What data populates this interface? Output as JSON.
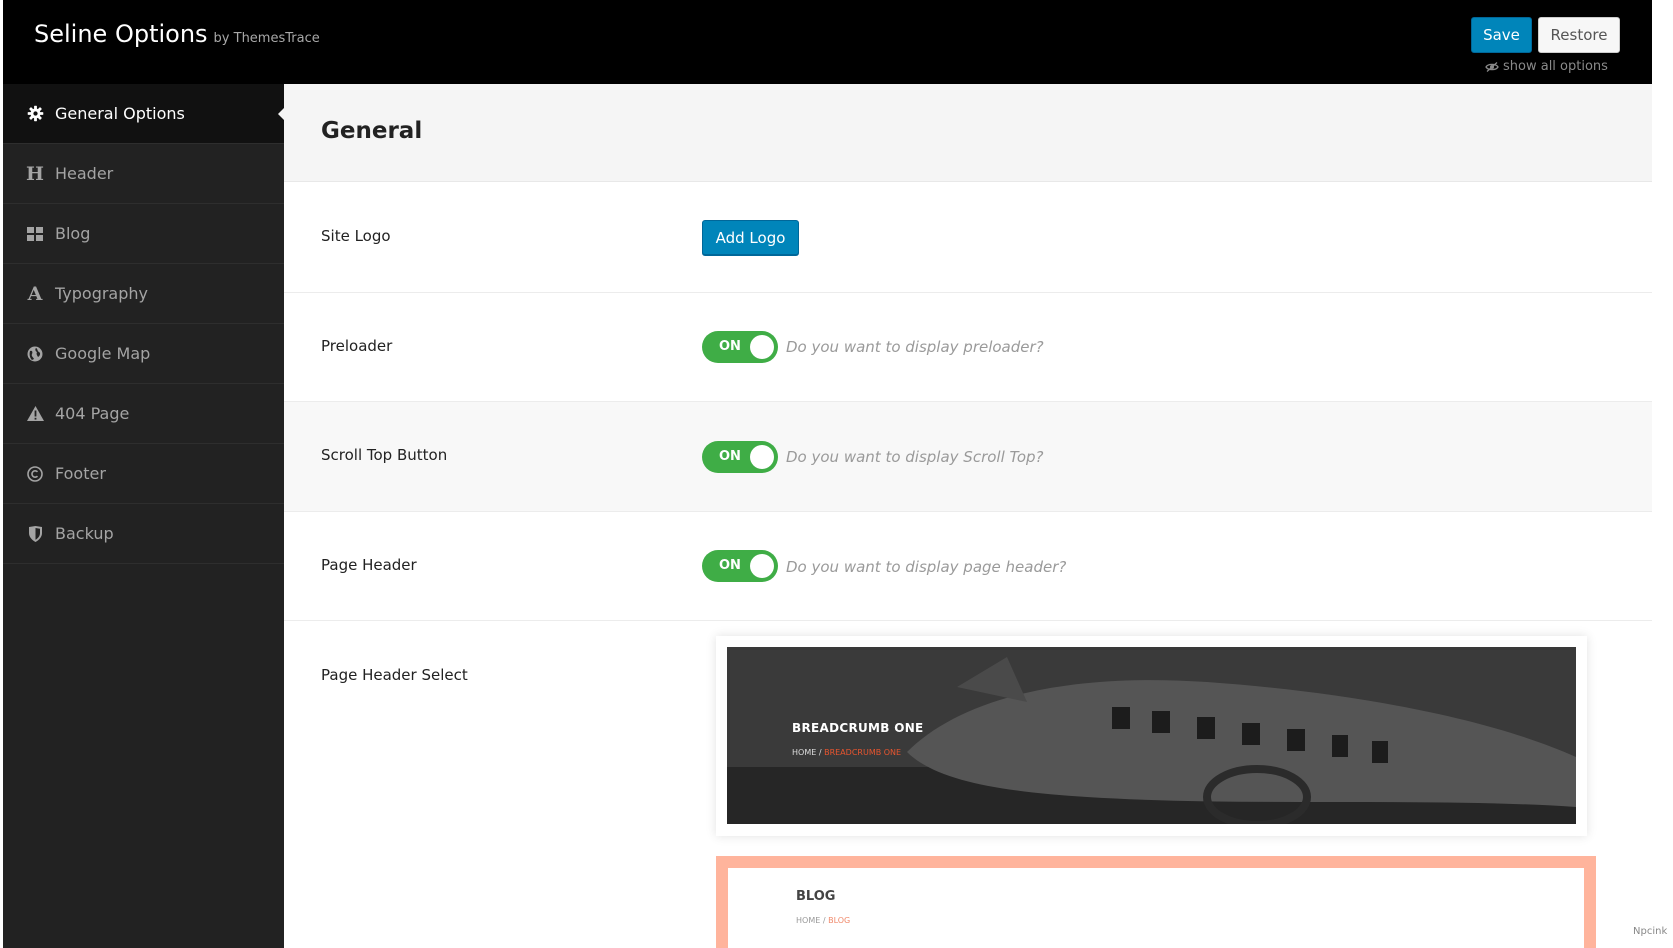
{
  "app": {
    "title": "Seline Options",
    "by": "by ThemesTrace"
  },
  "toolbar": {
    "save_label": "Save",
    "restore_label": "Restore",
    "show_all_label": "show all options"
  },
  "sidebar": {
    "items": [
      {
        "label": "General Options",
        "icon": "gear-icon",
        "active": true
      },
      {
        "label": "Header",
        "icon": "heading-icon"
      },
      {
        "label": "Blog",
        "icon": "grid-icon"
      },
      {
        "label": "Typography",
        "icon": "font-icon"
      },
      {
        "label": "Google Map",
        "icon": "globe-icon"
      },
      {
        "label": "404 Page",
        "icon": "warning-icon"
      },
      {
        "label": "Footer",
        "icon": "copyright-icon"
      },
      {
        "label": "Backup",
        "icon": "shield-icon"
      }
    ]
  },
  "main": {
    "title": "General",
    "site_logo": {
      "label": "Site Logo",
      "button": "Add Logo"
    },
    "preloader": {
      "label": "Preloader",
      "state": "ON",
      "description": "Do you want to display preloader?"
    },
    "scroll_top": {
      "label": "Scroll Top Button",
      "state": "ON",
      "description": "Do you want to display Scroll Top?"
    },
    "page_header": {
      "label": "Page Header",
      "state": "ON",
      "description": "Do you want to display page header?"
    },
    "page_header_select": {
      "label": "Page Header Select",
      "options": [
        {
          "title": "BREADCRUMB ONE",
          "home": "HOME",
          "separator": "/",
          "current": "BREADCRUMB ONE"
        },
        {
          "title": "BLOG",
          "home": "HOME",
          "separator": "/",
          "current": "BLOG"
        }
      ]
    }
  },
  "corner_note": "Npcink",
  "colors": {
    "accent": "#0085ba",
    "toggle_on": "#3fad46",
    "sidebar_bg": "#222222",
    "topbar_bg": "#000000",
    "breadcrumb_accent": "#e8552f",
    "selected_border": "#ffb49c"
  }
}
